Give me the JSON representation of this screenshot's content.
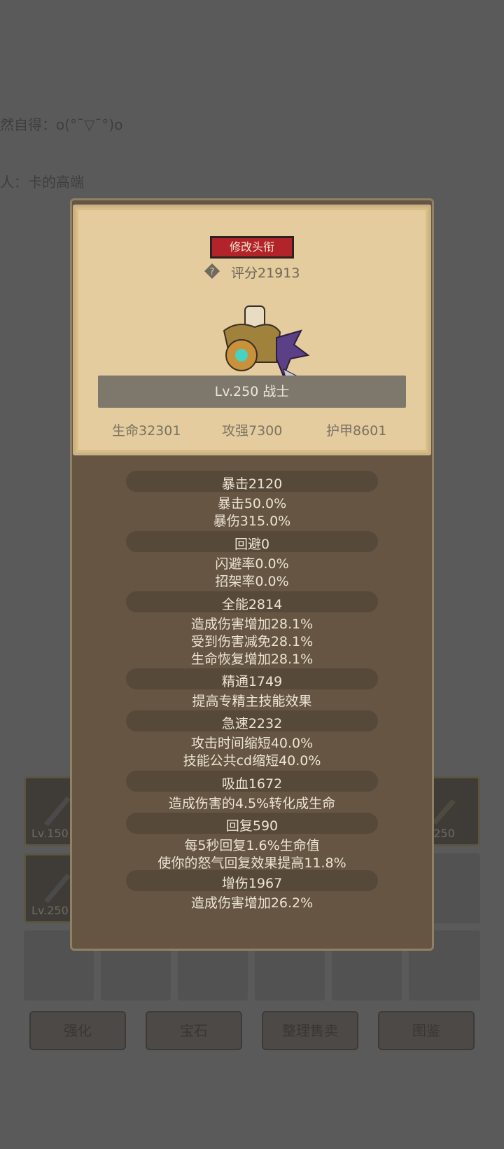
{
  "background": {
    "line1": "然自得：o(°¯▽¯°)o",
    "line2": "人：卡的高端",
    "slots_row1": [
      {
        "level": "Lv.150",
        "has_item": true
      },
      {
        "level": "Lv.250",
        "has_item": true
      }
    ],
    "slots_row2": [
      {
        "level": "Lv.250",
        "has_item": true
      }
    ],
    "buttons": [
      "强化",
      "宝石",
      "整理售卖",
      "图鉴"
    ]
  },
  "modal": {
    "rename_label": "修改头衔",
    "help_icon": "question-diamond-icon",
    "score": "评分21913",
    "level_class": "Lv.250 战士",
    "main_stats": {
      "hp": "生命32301",
      "attack": "攻强7300",
      "armor": "护甲8601"
    },
    "stats": [
      {
        "header": "暴击2120",
        "lines": [
          "暴击50.0%",
          "暴伤315.0%"
        ]
      },
      {
        "header": "回避0",
        "lines": [
          "闪避率0.0%",
          "招架率0.0%"
        ]
      },
      {
        "header": "全能2814",
        "lines": [
          "造成伤害增加28.1%",
          "受到伤害减免28.1%",
          "生命恢复增加28.1%"
        ]
      },
      {
        "header": "精通1749",
        "lines": [
          "提高专精主技能效果"
        ]
      },
      {
        "header": "急速2232",
        "lines": [
          "攻击时间缩短40.0%",
          "技能公共cd缩短40.0%"
        ]
      },
      {
        "header": "吸血1672",
        "lines": [
          "造成伤害的4.5%转化成生命"
        ]
      },
      {
        "header": "回复590",
        "lines": [
          "每5秒回复1.6%生命值",
          "使你的怒气回复效果提高11.8%"
        ]
      },
      {
        "header": "增伤1967",
        "lines": [
          "造成伤害增加26.2%"
        ]
      }
    ]
  },
  "colors": {
    "modal_bg": "#655542",
    "parchment": "#e4cc9e",
    "rename_button": "#b3232a",
    "stat_text": "#ede4d4"
  }
}
